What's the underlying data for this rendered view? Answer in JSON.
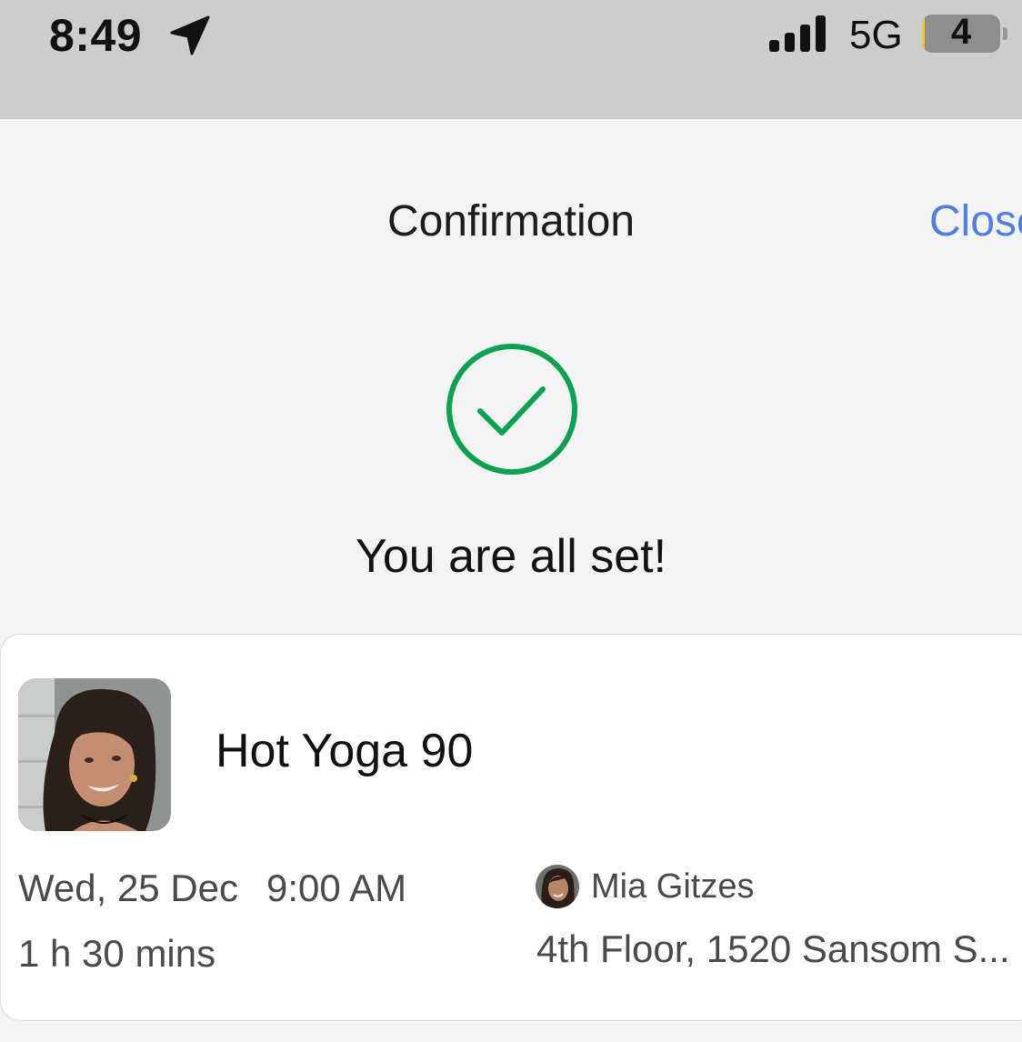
{
  "status_bar": {
    "time": "8:49",
    "location_icon": "location-arrow-icon",
    "signal_icon": "cellular-signal-icon",
    "network": "5G",
    "battery_level": "4",
    "battery_fraction": 0.04
  },
  "header": {
    "title": "Confirmation",
    "close_label": "Close"
  },
  "success": {
    "icon": "checkmark-circle-icon",
    "message": "You are all set!",
    "icon_color": "#0aa150"
  },
  "booking": {
    "class_name": "Hot Yoga 90",
    "date": "Wed, 25 Dec",
    "time": "9:00 AM",
    "duration": "1 h 30 mins",
    "instructor": "Mia Gitzes",
    "location": "4th Floor, 1520 Sansom S..."
  },
  "colors": {
    "accent_link": "#4f7fe0",
    "success_green": "#0aa150",
    "status_bar_bg": "#cdcdcd",
    "page_bg": "#f3f3f3"
  }
}
